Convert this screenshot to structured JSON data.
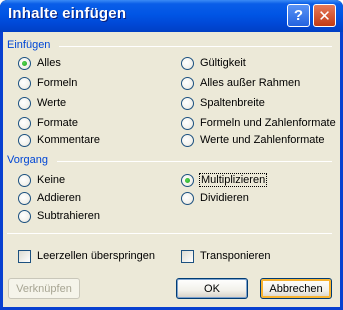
{
  "window": {
    "title": "Inhalte einfügen"
  },
  "titlebar": {
    "help_glyph": "?",
    "close_glyph": "✕"
  },
  "einfuegen": {
    "label": "Einfügen",
    "options_left": [
      "Alles",
      "Formeln",
      "Werte",
      "Formate",
      "Kommentare"
    ],
    "options_right": [
      "Gültigkeit",
      "Alles außer Rahmen",
      "Spaltenbreite",
      "Formeln und Zahlenformate",
      "Werte und Zahlenformate"
    ],
    "selected": "Alles"
  },
  "vorgang": {
    "label": "Vorgang",
    "options_left": [
      "Keine",
      "Addieren",
      "Subtrahieren"
    ],
    "options_right": [
      "Multiplizieren",
      "Dividieren"
    ],
    "selected": "Multiplizieren"
  },
  "checkboxes": {
    "skip_blanks": {
      "label": "Leerzellen überspringen",
      "checked": false
    },
    "transpose": {
      "label": "Transponieren",
      "checked": false
    }
  },
  "buttons": {
    "link": "Verknüpfen",
    "ok": "OK",
    "cancel": "Abbrechen"
  }
}
